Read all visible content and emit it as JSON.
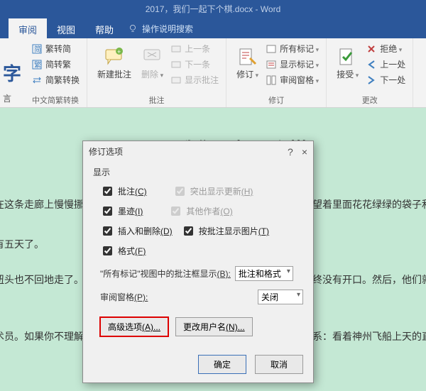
{
  "titlebar": "2017，我们一起下个棋.docx - Word",
  "tabs": {
    "review": "审阅",
    "view": "视图",
    "help": "帮助",
    "search": "操作说明搜索"
  },
  "ribbon": {
    "char_partial": "字",
    "edge_label": "言",
    "simp": "繁转简",
    "trad": "简转繁",
    "convert": "简繁转换",
    "group_lang": "中文简繁转换",
    "new_comment": "新建批注",
    "delete": "删除",
    "prev": "上一条",
    "next": "下一条",
    "show_comments": "显示批注",
    "group_comments": "批注",
    "track": "修订",
    "all_markup": "所有标记",
    "show_markup": "显示标记",
    "review_pane": "审阅窗格",
    "group_track": "修订",
    "accept": "接受",
    "reject": "拒绝",
    "prev2": "上一处",
    "next2": "下一处",
    "group_changes": "更改"
  },
  "doc": {
    "title_partial": "2017，我们一起下个棋",
    "line1_left": "在这条走廊上慢慢挪",
    "line1_right": "芹望着里面花花绿绿的袋子和",
    "line2_left": "有五天了。",
    "line3_left": "扭头也不回地走了。",
    "line3_right": "最终没有开口。然后，他们就",
    "line4_left": "术员。如果你不理解",
    "line4_right": "关系：看着神州飞船上天的直"
  },
  "dialog": {
    "title": "修订选项",
    "help": "?",
    "close": "×",
    "display": "显示",
    "chk_comments": "批注",
    "hot_c": "(C)",
    "chk_highlight": "突出显示更新",
    "hot_h": "(H)",
    "chk_ink": "墨迹",
    "hot_i": "(I)",
    "chk_others": "其他作者",
    "hot_o": "(O)",
    "chk_insdel": "插入和删除",
    "hot_d": "(D)",
    "chk_pic": "按批注显示图片",
    "hot_t": "(T)",
    "chk_format": "格式",
    "hot_f": "(F)",
    "balloon_label_pre": "\"所有标记\"视图中的批注框显示",
    "balloon_hot": "(B):",
    "balloon_value": "批注和格式",
    "pane_label": "审阅窗格",
    "pane_hot": "(P):",
    "pane_value": "关闭",
    "advanced": "高级选项",
    "advanced_hot": "(A)...",
    "username": "更改用户名",
    "username_hot": "(N)...",
    "ok": "确定",
    "cancel": "取消"
  }
}
